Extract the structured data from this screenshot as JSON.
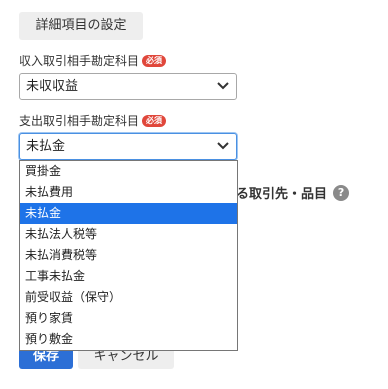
{
  "section_button_label": "詳細項目の設定",
  "income_field": {
    "label": "収入取引相手勘定科目",
    "required_badge": "必須",
    "value": "未収収益"
  },
  "expense_field": {
    "label": "支出取引相手勘定科目",
    "required_badge": "必須",
    "value": "未払金"
  },
  "partial_background_text": "る取引先・品目",
  "help_icon_glyph": "?",
  "buttons": {
    "save": "保存",
    "cancel": "キャンセル"
  },
  "dropdown": {
    "selected_index": 2,
    "options": [
      "買掛金",
      "未払費用",
      "未払金",
      "未払法人税等",
      "未払消費税等",
      "工事未払金",
      "前受収益（保守）",
      "預り家賃",
      "預り敷金"
    ]
  },
  "colors": {
    "accent": "#1e73e8",
    "required_badge": "#e0473b",
    "save_button": "#2c6fd6"
  }
}
